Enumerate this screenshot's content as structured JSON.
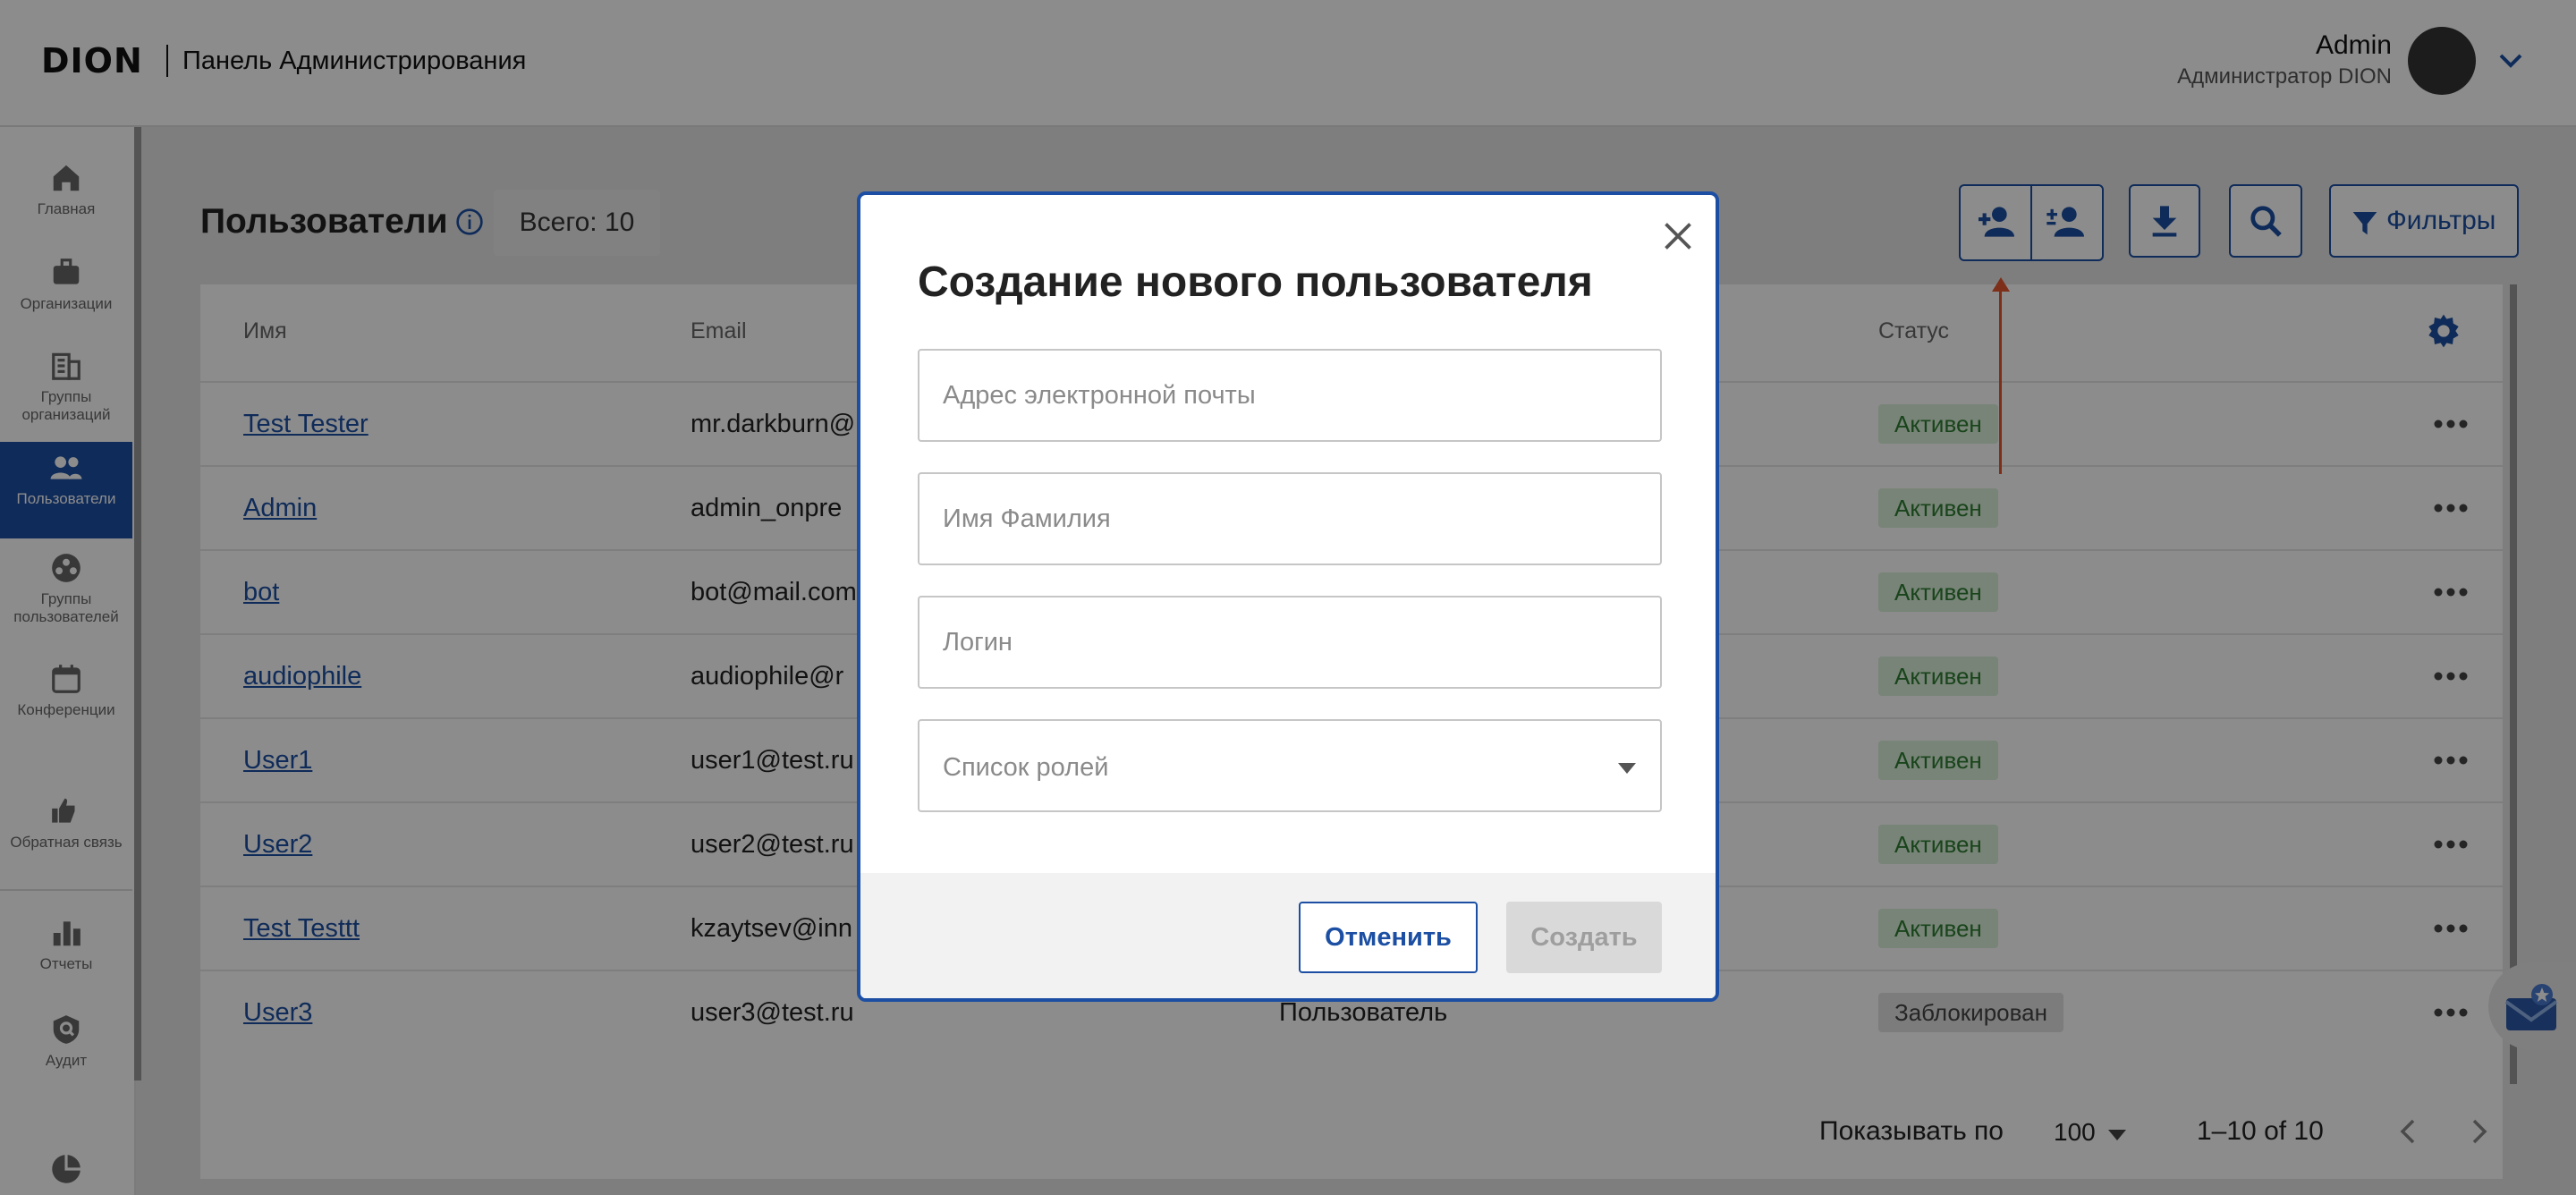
{
  "header": {
    "logo": "DION",
    "app_title": "Панель Администрирования",
    "user_name": "Admin",
    "user_role": "Администратор DION"
  },
  "sidebar": {
    "items": [
      {
        "label": "Главная",
        "icon": "home-icon"
      },
      {
        "label": "Организации",
        "icon": "briefcase-icon"
      },
      {
        "label": "Группы организаций",
        "icon": "buildings-icon"
      },
      {
        "label": "Пользователи",
        "icon": "users-icon",
        "active": true
      },
      {
        "label": "Группы пользователей",
        "icon": "user-group-icon"
      },
      {
        "label": "Конференции",
        "icon": "calendar-icon"
      },
      {
        "label": "Обратная связь",
        "icon": "thumbs-icon"
      },
      {
        "label": "Отчеты",
        "icon": "bar-chart-icon"
      },
      {
        "label": "Аудит",
        "icon": "audit-shield-icon"
      }
    ]
  },
  "page": {
    "title": "Пользователи",
    "total": "Всего: 10",
    "filters_label": "Фильтры"
  },
  "table": {
    "columns": [
      "Имя",
      "Email",
      "Статус"
    ],
    "rows": [
      {
        "name": "Test Tester",
        "email": "mr.darkburn@",
        "role": "",
        "status": "Активен"
      },
      {
        "name": "Admin",
        "email": "admin_onpre",
        "role": "",
        "status": "Активен"
      },
      {
        "name": "bot",
        "email": "bot@mail.com",
        "role": "",
        "status": "Активен"
      },
      {
        "name": "audiophile",
        "email": "audiophile@r",
        "role": "",
        "status": "Активен"
      },
      {
        "name": "User1",
        "email": "user1@test.ru",
        "role": "",
        "status": "Активен"
      },
      {
        "name": "User2",
        "email": "user2@test.ru",
        "role": "",
        "status": "Активен"
      },
      {
        "name": "Test Testtt",
        "email": "kzaytsev@inn",
        "role": "",
        "status": "Активен"
      },
      {
        "name": "User3",
        "email": "user3@test.ru",
        "role": "Пользователь",
        "status": "Заблокирован"
      }
    ]
  },
  "pager": {
    "label": "Показывать по",
    "page_size": "100",
    "range": "1–10 of 10"
  },
  "modal": {
    "title": "Создание нового пользователя",
    "email_placeholder": "Адрес электронной почты",
    "name_placeholder": "Имя Фамилия",
    "login_placeholder": "Логин",
    "roles_placeholder": "Список ролей",
    "cancel_label": "Отменить",
    "create_label": "Создать"
  },
  "colors": {
    "accent": "#1c4fa3",
    "active_status": "#2e7d32",
    "annotation": "#e4572e"
  }
}
